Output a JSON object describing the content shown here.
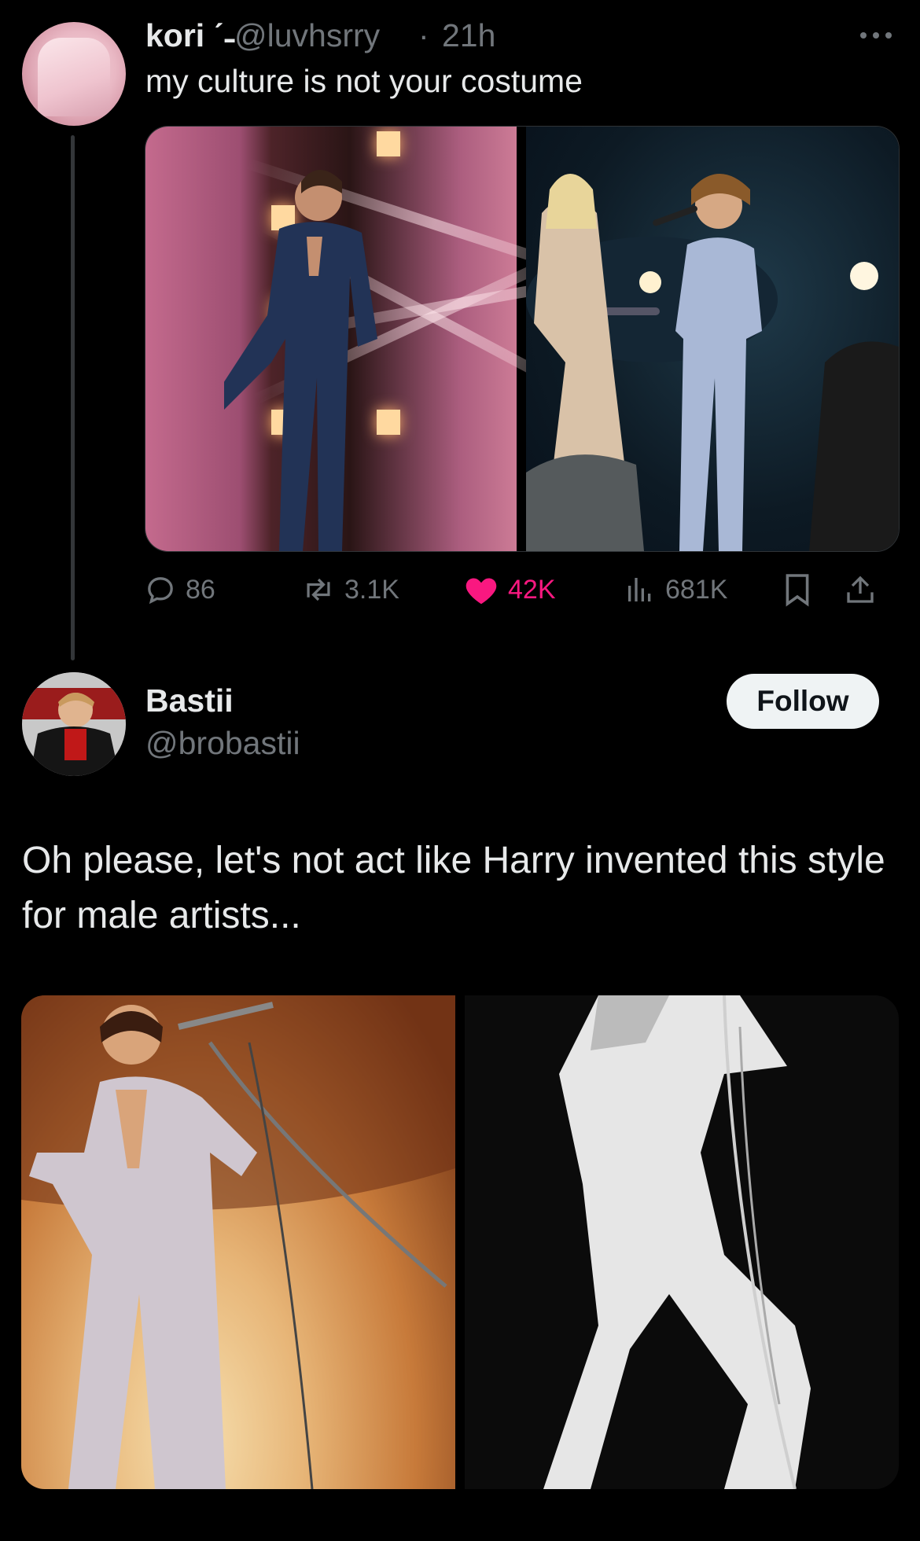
{
  "first_tweet": {
    "display_name": "kori ˊ˗",
    "handle": "@luvhsrry",
    "separator": "·",
    "time": "21h",
    "text": "my culture is not your costume",
    "metrics": {
      "replies": "86",
      "reposts": "3.1K",
      "likes": "42K",
      "views": "681K"
    },
    "liked_color": "#f91880"
  },
  "second_tweet": {
    "display_name": "Bastii",
    "handle": "@brobastii",
    "follow_label": "Follow",
    "text": "Oh please, let's not act like Harry invented this style for male artists..."
  },
  "icons": {
    "more": "more-dots-icon",
    "reply": "reply-bubble-icon",
    "repost": "repost-arrows-icon",
    "like": "heart-icon",
    "views": "views-bars-icon",
    "bookmark": "bookmark-icon",
    "share": "share-upload-icon"
  },
  "colors": {
    "background": "#000000",
    "text_primary": "#e7e9ea",
    "text_secondary": "#71767b",
    "like_pink": "#f91880",
    "follow_button_bg": "#eff3f4"
  }
}
